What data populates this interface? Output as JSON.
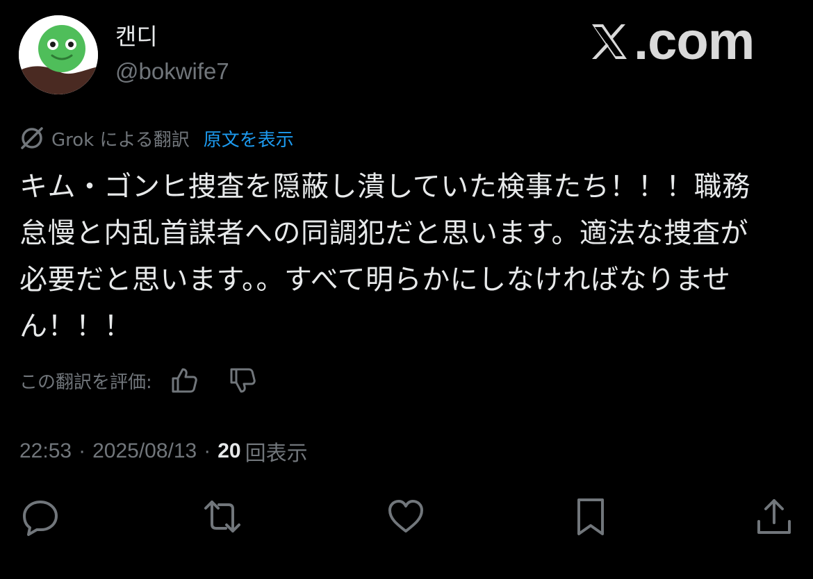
{
  "author": {
    "display_name": "캔디",
    "handle": "@bokwife7",
    "avatar_icon": "green-smiley-avatar"
  },
  "watermark": {
    "text": ".com",
    "icon": "x-logo-icon"
  },
  "translation": {
    "icon": "grok-icon",
    "label": "Grok による翻訳",
    "show_original": "原文を表示"
  },
  "post": {
    "text": "キム・ゴンヒ捜査を隠蔽し潰していた検事たち！！！職務\n怠慢と内乱首謀者への同調犯だと思います。適法な捜査が\n必要だと思います。。すべて明らかにしなければなりませ\nん！！！"
  },
  "rating": {
    "label": "この翻訳を評価:",
    "thumbs_up_icon": "thumbs-up-icon",
    "thumbs_down_icon": "thumbs-down-icon"
  },
  "meta": {
    "time": "22:53",
    "separator": "·",
    "date": "2025/08/13",
    "views_count": "20",
    "views_label": "回表示"
  },
  "actions": [
    {
      "name": "reply",
      "icon": "reply-icon"
    },
    {
      "name": "repost",
      "icon": "repost-icon"
    },
    {
      "name": "like",
      "icon": "heart-icon"
    },
    {
      "name": "bookmark",
      "icon": "bookmark-icon"
    },
    {
      "name": "share",
      "icon": "share-icon"
    }
  ],
  "colors": {
    "background": "#000000",
    "primary_text": "#e7e9ea",
    "secondary_text": "#71767b",
    "link": "#1d9bf0",
    "avatar_green": "#4fbe5a"
  }
}
